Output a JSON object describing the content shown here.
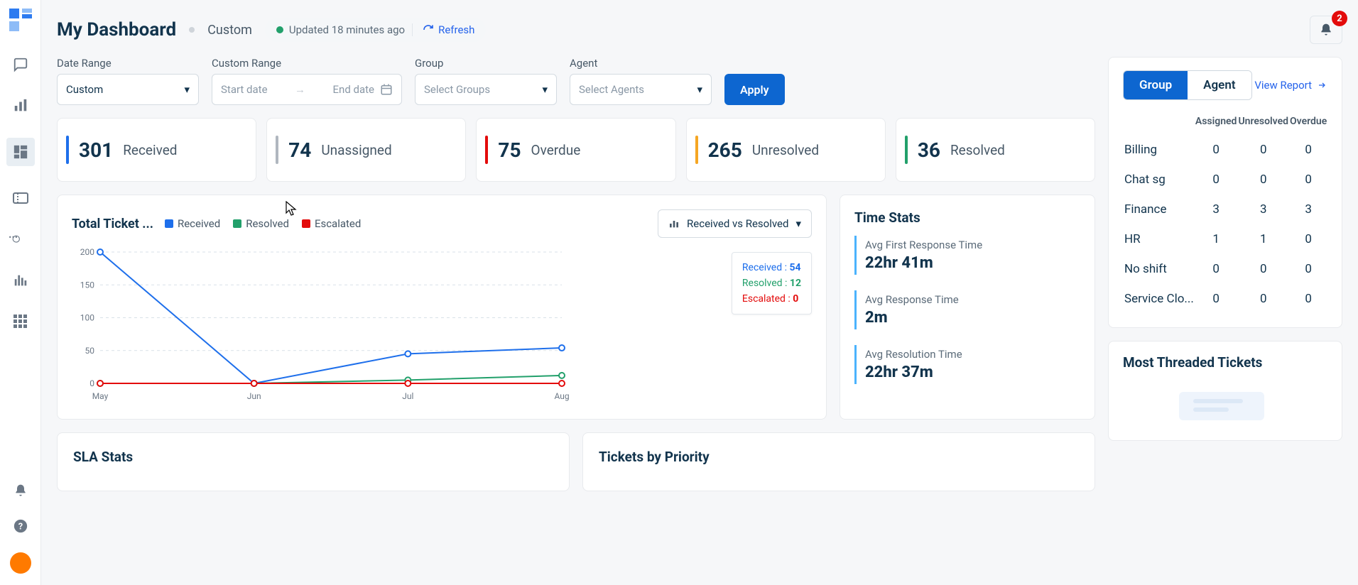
{
  "header": {
    "title": "My Dashboard",
    "mode": "Custom",
    "updated": "Updated 18 minutes ago",
    "refresh": "Refresh",
    "notif_count": "2"
  },
  "filters": {
    "date_range_label": "Date Range",
    "date_range_value": "Custom",
    "custom_range_label": "Custom Range",
    "start_placeholder": "Start date",
    "end_placeholder": "End date",
    "group_label": "Group",
    "group_placeholder": "Select Groups",
    "agent_label": "Agent",
    "agent_placeholder": "Select Agents",
    "apply": "Apply"
  },
  "stats": [
    {
      "value": "301",
      "label": "Received",
      "color": "#1e6feb"
    },
    {
      "value": "74",
      "label": "Unassigned",
      "color": "#b0b7bf"
    },
    {
      "value": "75",
      "label": "Overdue",
      "color": "#e30b0b"
    },
    {
      "value": "265",
      "label": "Unresolved",
      "color": "#f5a623"
    },
    {
      "value": "36",
      "label": "Resolved",
      "color": "#22a06b"
    }
  ],
  "chart": {
    "title": "Total Ticket ...",
    "legend": {
      "received": "Received",
      "resolved": "Resolved",
      "escalated": "Escalated"
    },
    "select": "Received vs Resolved",
    "tooltip": {
      "received_label": "Received :",
      "received_val": "54",
      "resolved_label": "Resolved :",
      "resolved_val": "12",
      "escalated_label": "Escalated :",
      "escalated_val": "0"
    }
  },
  "chart_data": {
    "type": "line",
    "title": "Total Ticket ...",
    "categories": [
      "May",
      "Jun",
      "Jul",
      "Aug"
    ],
    "ylim": [
      0,
      200
    ],
    "yticks": [
      0,
      50,
      100,
      150,
      200
    ],
    "series": [
      {
        "name": "Received",
        "color": "#1e6feb",
        "values": [
          200,
          0,
          45,
          54
        ]
      },
      {
        "name": "Resolved",
        "color": "#22a06b",
        "values": [
          0,
          0,
          5,
          12
        ]
      },
      {
        "name": "Escalated",
        "color": "#e30b0b",
        "values": [
          0,
          0,
          0,
          0
        ]
      }
    ]
  },
  "time_stats": {
    "title": "Time Stats",
    "items": [
      {
        "label": "Avg First Response Time",
        "value": "22hr 41m"
      },
      {
        "label": "Avg Response Time",
        "value": "2m"
      },
      {
        "label": "Avg Resolution Time",
        "value": "22hr 37m"
      }
    ]
  },
  "bottom": {
    "sla": "SLA Stats",
    "priority": "Tickets by Priority"
  },
  "right": {
    "group": "Group",
    "agent": "Agent",
    "view_report": "View Report",
    "cols": [
      "Assigned",
      "Unresolved",
      "Overdue"
    ],
    "rows": [
      {
        "name": "Billing",
        "a": "0",
        "u": "0",
        "o": "0"
      },
      {
        "name": "Chat sg",
        "a": "0",
        "u": "0",
        "o": "0"
      },
      {
        "name": "Finance",
        "a": "3",
        "u": "3",
        "o": "3"
      },
      {
        "name": "HR",
        "a": "1",
        "u": "1",
        "o": "0"
      },
      {
        "name": "No shift",
        "a": "0",
        "u": "0",
        "o": "0"
      },
      {
        "name": "Service Clo...",
        "a": "0",
        "u": "0",
        "o": "0"
      }
    ],
    "threaded_title": "Most Threaded Tickets"
  }
}
